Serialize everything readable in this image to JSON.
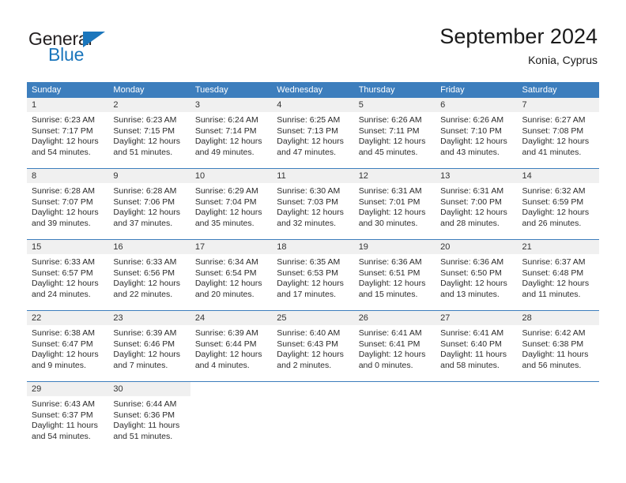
{
  "brand": {
    "name_top": "General",
    "name_bottom": "Blue",
    "color_blue": "#1b76bc",
    "color_dark": "#231f20"
  },
  "header": {
    "title": "September 2024",
    "subtitle": "Konia, Cyprus"
  },
  "theme": {
    "header_blue": "#3d7ebd",
    "day_strip_gray": "#f0f0f0",
    "text_dark": "#2b2b2b"
  },
  "calendar": {
    "weekday_headers": [
      "Sunday",
      "Monday",
      "Tuesday",
      "Wednesday",
      "Thursday",
      "Friday",
      "Saturday"
    ],
    "weeks": [
      [
        {
          "day": "1",
          "sunrise": "Sunrise: 6:23 AM",
          "sunset": "Sunset: 7:17 PM",
          "daylight1": "Daylight: 12 hours",
          "daylight2": "and 54 minutes."
        },
        {
          "day": "2",
          "sunrise": "Sunrise: 6:23 AM",
          "sunset": "Sunset: 7:15 PM",
          "daylight1": "Daylight: 12 hours",
          "daylight2": "and 51 minutes."
        },
        {
          "day": "3",
          "sunrise": "Sunrise: 6:24 AM",
          "sunset": "Sunset: 7:14 PM",
          "daylight1": "Daylight: 12 hours",
          "daylight2": "and 49 minutes."
        },
        {
          "day": "4",
          "sunrise": "Sunrise: 6:25 AM",
          "sunset": "Sunset: 7:13 PM",
          "daylight1": "Daylight: 12 hours",
          "daylight2": "and 47 minutes."
        },
        {
          "day": "5",
          "sunrise": "Sunrise: 6:26 AM",
          "sunset": "Sunset: 7:11 PM",
          "daylight1": "Daylight: 12 hours",
          "daylight2": "and 45 minutes."
        },
        {
          "day": "6",
          "sunrise": "Sunrise: 6:26 AM",
          "sunset": "Sunset: 7:10 PM",
          "daylight1": "Daylight: 12 hours",
          "daylight2": "and 43 minutes."
        },
        {
          "day": "7",
          "sunrise": "Sunrise: 6:27 AM",
          "sunset": "Sunset: 7:08 PM",
          "daylight1": "Daylight: 12 hours",
          "daylight2": "and 41 minutes."
        }
      ],
      [
        {
          "day": "8",
          "sunrise": "Sunrise: 6:28 AM",
          "sunset": "Sunset: 7:07 PM",
          "daylight1": "Daylight: 12 hours",
          "daylight2": "and 39 minutes."
        },
        {
          "day": "9",
          "sunrise": "Sunrise: 6:28 AM",
          "sunset": "Sunset: 7:06 PM",
          "daylight1": "Daylight: 12 hours",
          "daylight2": "and 37 minutes."
        },
        {
          "day": "10",
          "sunrise": "Sunrise: 6:29 AM",
          "sunset": "Sunset: 7:04 PM",
          "daylight1": "Daylight: 12 hours",
          "daylight2": "and 35 minutes."
        },
        {
          "day": "11",
          "sunrise": "Sunrise: 6:30 AM",
          "sunset": "Sunset: 7:03 PM",
          "daylight1": "Daylight: 12 hours",
          "daylight2": "and 32 minutes."
        },
        {
          "day": "12",
          "sunrise": "Sunrise: 6:31 AM",
          "sunset": "Sunset: 7:01 PM",
          "daylight1": "Daylight: 12 hours",
          "daylight2": "and 30 minutes."
        },
        {
          "day": "13",
          "sunrise": "Sunrise: 6:31 AM",
          "sunset": "Sunset: 7:00 PM",
          "daylight1": "Daylight: 12 hours",
          "daylight2": "and 28 minutes."
        },
        {
          "day": "14",
          "sunrise": "Sunrise: 6:32 AM",
          "sunset": "Sunset: 6:59 PM",
          "daylight1": "Daylight: 12 hours",
          "daylight2": "and 26 minutes."
        }
      ],
      [
        {
          "day": "15",
          "sunrise": "Sunrise: 6:33 AM",
          "sunset": "Sunset: 6:57 PM",
          "daylight1": "Daylight: 12 hours",
          "daylight2": "and 24 minutes."
        },
        {
          "day": "16",
          "sunrise": "Sunrise: 6:33 AM",
          "sunset": "Sunset: 6:56 PM",
          "daylight1": "Daylight: 12 hours",
          "daylight2": "and 22 minutes."
        },
        {
          "day": "17",
          "sunrise": "Sunrise: 6:34 AM",
          "sunset": "Sunset: 6:54 PM",
          "daylight1": "Daylight: 12 hours",
          "daylight2": "and 20 minutes."
        },
        {
          "day": "18",
          "sunrise": "Sunrise: 6:35 AM",
          "sunset": "Sunset: 6:53 PM",
          "daylight1": "Daylight: 12 hours",
          "daylight2": "and 17 minutes."
        },
        {
          "day": "19",
          "sunrise": "Sunrise: 6:36 AM",
          "sunset": "Sunset: 6:51 PM",
          "daylight1": "Daylight: 12 hours",
          "daylight2": "and 15 minutes."
        },
        {
          "day": "20",
          "sunrise": "Sunrise: 6:36 AM",
          "sunset": "Sunset: 6:50 PM",
          "daylight1": "Daylight: 12 hours",
          "daylight2": "and 13 minutes."
        },
        {
          "day": "21",
          "sunrise": "Sunrise: 6:37 AM",
          "sunset": "Sunset: 6:48 PM",
          "daylight1": "Daylight: 12 hours",
          "daylight2": "and 11 minutes."
        }
      ],
      [
        {
          "day": "22",
          "sunrise": "Sunrise: 6:38 AM",
          "sunset": "Sunset: 6:47 PM",
          "daylight1": "Daylight: 12 hours",
          "daylight2": "and 9 minutes."
        },
        {
          "day": "23",
          "sunrise": "Sunrise: 6:39 AM",
          "sunset": "Sunset: 6:46 PM",
          "daylight1": "Daylight: 12 hours",
          "daylight2": "and 7 minutes."
        },
        {
          "day": "24",
          "sunrise": "Sunrise: 6:39 AM",
          "sunset": "Sunset: 6:44 PM",
          "daylight1": "Daylight: 12 hours",
          "daylight2": "and 4 minutes."
        },
        {
          "day": "25",
          "sunrise": "Sunrise: 6:40 AM",
          "sunset": "Sunset: 6:43 PM",
          "daylight1": "Daylight: 12 hours",
          "daylight2": "and 2 minutes."
        },
        {
          "day": "26",
          "sunrise": "Sunrise: 6:41 AM",
          "sunset": "Sunset: 6:41 PM",
          "daylight1": "Daylight: 12 hours",
          "daylight2": "and 0 minutes."
        },
        {
          "day": "27",
          "sunrise": "Sunrise: 6:41 AM",
          "sunset": "Sunset: 6:40 PM",
          "daylight1": "Daylight: 11 hours",
          "daylight2": "and 58 minutes."
        },
        {
          "day": "28",
          "sunrise": "Sunrise: 6:42 AM",
          "sunset": "Sunset: 6:38 PM",
          "daylight1": "Daylight: 11 hours",
          "daylight2": "and 56 minutes."
        }
      ],
      [
        {
          "day": "29",
          "sunrise": "Sunrise: 6:43 AM",
          "sunset": "Sunset: 6:37 PM",
          "daylight1": "Daylight: 11 hours",
          "daylight2": "and 54 minutes."
        },
        {
          "day": "30",
          "sunrise": "Sunrise: 6:44 AM",
          "sunset": "Sunset: 6:36 PM",
          "daylight1": "Daylight: 11 hours",
          "daylight2": "and 51 minutes."
        },
        {
          "day": "",
          "sunrise": "",
          "sunset": "",
          "daylight1": "",
          "daylight2": ""
        },
        {
          "day": "",
          "sunrise": "",
          "sunset": "",
          "daylight1": "",
          "daylight2": ""
        },
        {
          "day": "",
          "sunrise": "",
          "sunset": "",
          "daylight1": "",
          "daylight2": ""
        },
        {
          "day": "",
          "sunrise": "",
          "sunset": "",
          "daylight1": "",
          "daylight2": ""
        },
        {
          "day": "",
          "sunrise": "",
          "sunset": "",
          "daylight1": "",
          "daylight2": ""
        }
      ]
    ]
  }
}
